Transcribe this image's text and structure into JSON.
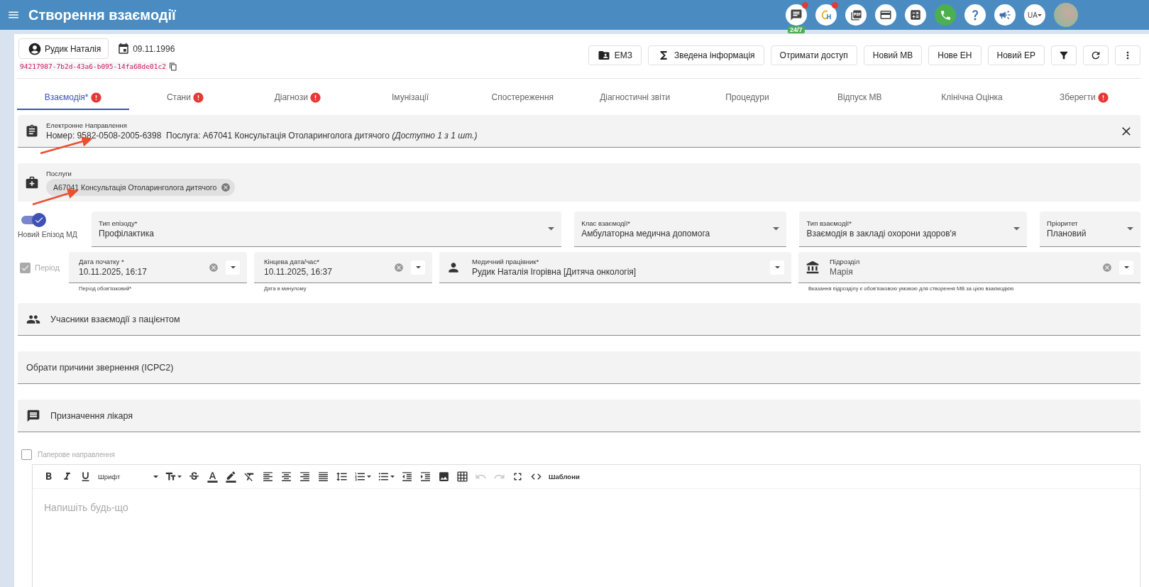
{
  "app_bar": {
    "title": "Створення взаємодії",
    "support_badge": "24/7",
    "language": "UA"
  },
  "patient": {
    "name": "Рудик Наталія",
    "birth_date": "09.11.1996",
    "id": "94217987-7b2d-43a6-b095-14fa68de01c2"
  },
  "actions": [
    {
      "label": "ЕМЗ",
      "kind": "records"
    },
    {
      "label": "Зведена інформація",
      "kind": "summary"
    },
    {
      "label": "Отримати доступ",
      "kind": "plain"
    },
    {
      "label": "Новий МВ",
      "kind": "plain"
    },
    {
      "label": "Нове ЕН",
      "kind": "plain"
    },
    {
      "label": "Новий ЕР",
      "kind": "plain"
    }
  ],
  "tabs": [
    {
      "label": "Взаємодія*",
      "selected": true,
      "error": true
    },
    {
      "label": "Стани",
      "selected": false,
      "error": true
    },
    {
      "label": "Діагнози",
      "selected": false,
      "error": true
    },
    {
      "label": "Імунізації",
      "selected": false,
      "error": false
    },
    {
      "label": "Спостереження",
      "selected": false,
      "error": false
    },
    {
      "label": "Діагностичні звіти",
      "selected": false,
      "error": false
    },
    {
      "label": "Процедури",
      "selected": false,
      "error": false
    },
    {
      "label": "Відпуск МВ",
      "selected": false,
      "error": false
    },
    {
      "label": "Клінічна Оцінка",
      "selected": false,
      "error": false
    },
    {
      "label": "Зберегти",
      "selected": false,
      "error": true
    }
  ],
  "referral": {
    "label": "Електронне Направлення",
    "value": "Номер: 9582-0508-2005-6398  Послуга: A67041 Консультація Отоларинголога дитячого *(Доступно 1 з 1 шт.)*"
  },
  "services": {
    "label": "Послуги",
    "chips": [
      "A67041 Консультація Отоларинголога дитячого"
    ]
  },
  "new_episode": {
    "label": "Новий Епізод МД",
    "on": true
  },
  "selects": [
    {
      "label": "Тип епізоду*",
      "value": "Профілактика"
    },
    {
      "label": "Клас взаємодії*",
      "value": "Амбулаторна медична допомога"
    },
    {
      "label": "Тип взаємодії*",
      "value": "Взаємодія в закладі охорони здоров'я"
    },
    {
      "label": "Пріоритет",
      "value": "Плановий"
    }
  ],
  "period": {
    "label": "Період",
    "checked": true,
    "disabled": true
  },
  "start": {
    "label": "Дата початку *",
    "value": "10.11.2025, 16:17",
    "helper": "Період обов'язковий*"
  },
  "end": {
    "label": "Кінцева дата/час*",
    "value": "10.11.2025, 16:37",
    "helper": "Дата в минулому"
  },
  "practitioner": {
    "label": "Медичний працівник*",
    "value": "Рудик Наталія Ігорівна [Дитяча онкологія]"
  },
  "division": {
    "label": "Підрозділ",
    "value": "Марія",
    "helper": "Вказання підрозділу є обов'язковою умовою для створення МВ за цією взаємодією"
  },
  "sections": [
    {
      "label": "Учасники взаємодії з пацієнтом",
      "kind": "participants"
    },
    {
      "label": "Обрати причини звернення (ICPC2)",
      "kind": "plain"
    },
    {
      "label": "Призначення лікаря",
      "kind": "note"
    }
  ],
  "paper_referral": {
    "label": "Паперове направлення",
    "checked": false
  },
  "editor": {
    "font": "Шрифт",
    "templates": "Шаблони",
    "placeholder": "Напишіть будь-що",
    "undo_disabled": true,
    "redo_disabled": true
  }
}
